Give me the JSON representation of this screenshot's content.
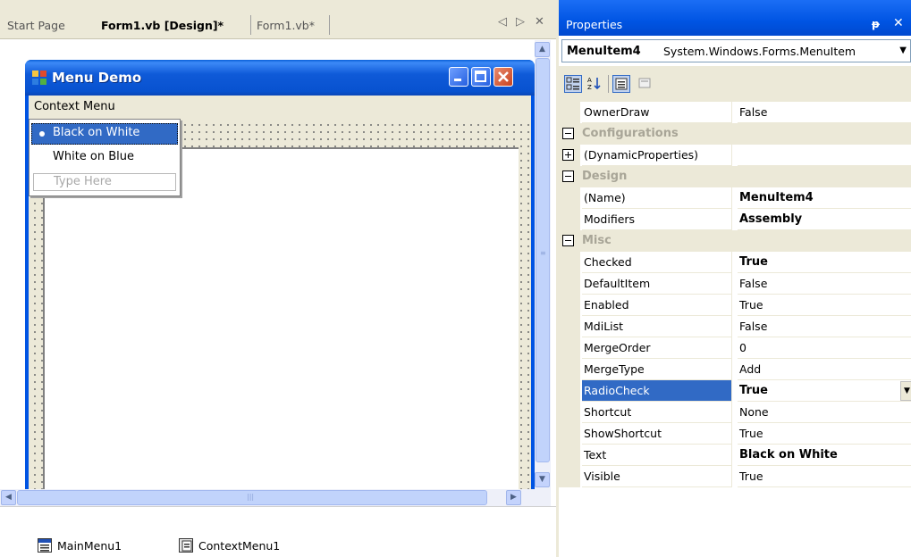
{
  "tabs": {
    "start_page": "Start Page",
    "form_design": "Form1.vb [Design]*",
    "form_code": "Form1.vb*",
    "nav_left": "◁",
    "nav_right": "▷",
    "close": "✕"
  },
  "form": {
    "title": "Menu Demo",
    "menubar_label": "Context Menu",
    "context_menu_items": [
      {
        "label": "Black on White",
        "selected": true,
        "radio_checked": true
      },
      {
        "label": "White on Blue",
        "selected": false,
        "radio_checked": false
      }
    ],
    "type_here": "Type Here"
  },
  "tray": {
    "main_menu": "MainMenu1",
    "context_menu": "ContextMenu1"
  },
  "properties": {
    "title": "Properties",
    "pin": "ᵽ",
    "close": "✕",
    "object_name": "MenuItem4",
    "object_type": "System.Windows.Forms.MenuItem",
    "rows": [
      {
        "kind": "prop",
        "name": "OwnerDraw",
        "value": "False",
        "bold": false
      },
      {
        "kind": "category",
        "name": "Configurations"
      },
      {
        "kind": "prop",
        "name": "(DynamicProperties)",
        "value": "",
        "bold": false,
        "expandable": true
      },
      {
        "kind": "category",
        "name": "Design"
      },
      {
        "kind": "prop",
        "name": "(Name)",
        "value": "MenuItem4",
        "bold": true
      },
      {
        "kind": "prop",
        "name": "Modifiers",
        "value": "Assembly",
        "bold": true
      },
      {
        "kind": "category",
        "name": "Misc"
      },
      {
        "kind": "prop",
        "name": "Checked",
        "value": "True",
        "bold": true
      },
      {
        "kind": "prop",
        "name": "DefaultItem",
        "value": "False",
        "bold": false
      },
      {
        "kind": "prop",
        "name": "Enabled",
        "value": "True",
        "bold": false
      },
      {
        "kind": "prop",
        "name": "MdiList",
        "value": "False",
        "bold": false
      },
      {
        "kind": "prop",
        "name": "MergeOrder",
        "value": "0",
        "bold": false
      },
      {
        "kind": "prop",
        "name": "MergeType",
        "value": "Add",
        "bold": false
      },
      {
        "kind": "prop",
        "name": "RadioCheck",
        "value": "True",
        "bold": true,
        "selected": true
      },
      {
        "kind": "prop",
        "name": "Shortcut",
        "value": "None",
        "bold": false
      },
      {
        "kind": "prop",
        "name": "ShowShortcut",
        "value": "True",
        "bold": false
      },
      {
        "kind": "prop",
        "name": "Text",
        "value": "Black on White",
        "bold": true
      },
      {
        "kind": "prop",
        "name": "Visible",
        "value": "True",
        "bold": false
      }
    ]
  },
  "colors": {
    "xp_blue": "#0054e3",
    "selection": "#316ac5",
    "chrome": "#ece9d8"
  }
}
